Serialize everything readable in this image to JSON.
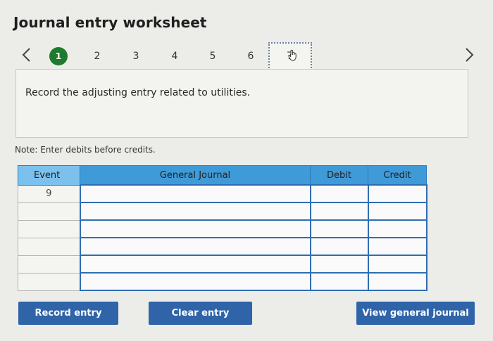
{
  "title": "Journal entry worksheet",
  "nav": {
    "steps": [
      "1",
      "2",
      "3",
      "4",
      "5",
      "6",
      "7"
    ],
    "active_step": "1"
  },
  "prompt": "Record the adjusting entry related to utilities.",
  "note": "Note: Enter debits before credits.",
  "table": {
    "headers": {
      "event": "Event",
      "general_journal": "General Journal",
      "debit": "Debit",
      "credit": "Credit"
    },
    "rows": [
      {
        "event": "9",
        "general_journal": "",
        "debit": "",
        "credit": ""
      },
      {
        "event": "",
        "general_journal": "",
        "debit": "",
        "credit": ""
      },
      {
        "event": "",
        "general_journal": "",
        "debit": "",
        "credit": ""
      },
      {
        "event": "",
        "general_journal": "",
        "debit": "",
        "credit": ""
      },
      {
        "event": "",
        "general_journal": "",
        "debit": "",
        "credit": ""
      },
      {
        "event": "",
        "general_journal": "",
        "debit": "",
        "credit": ""
      }
    ]
  },
  "buttons": {
    "record": "Record entry",
    "clear": "Clear entry",
    "view": "View general journal"
  },
  "colors": {
    "active_step": "#1e7a2e",
    "header_blue": "#3f9ad8",
    "button_blue": "#2f64a8"
  }
}
